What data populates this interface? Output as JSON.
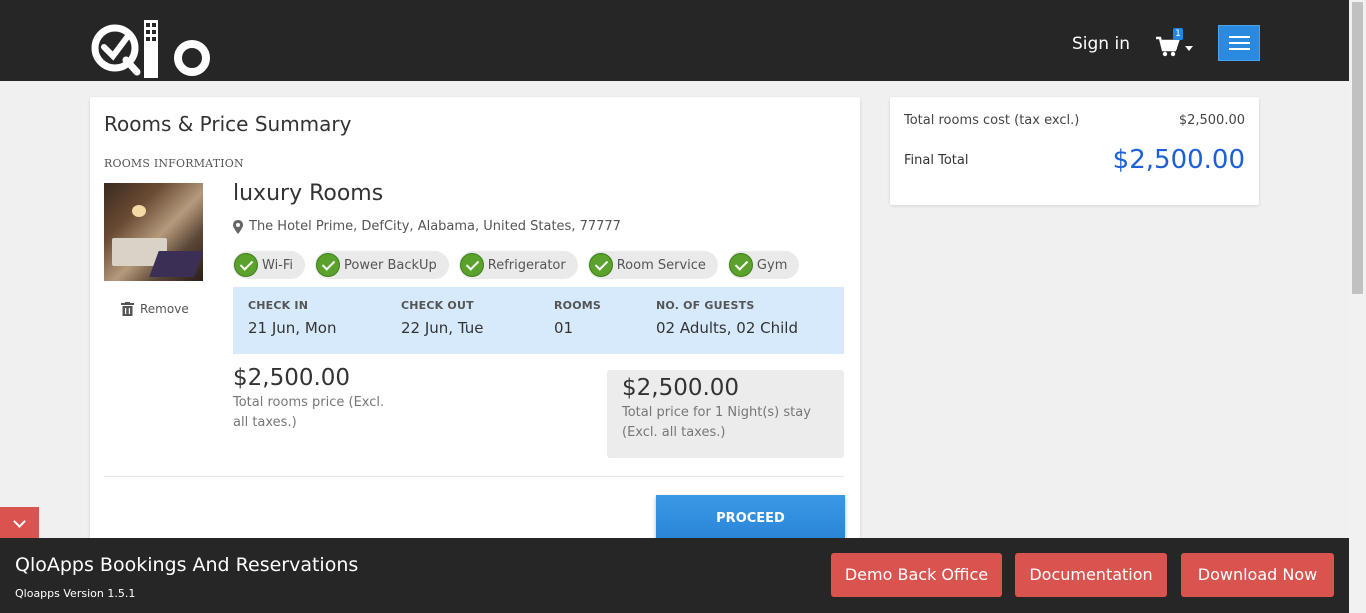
{
  "header": {
    "brand": "Qlo",
    "signin_label": "Sign in",
    "cart_count": "1"
  },
  "summary_card": {
    "title": "Rooms & Price Summary",
    "section_label": "ROOMS INFORMATION",
    "room": {
      "name": "luxury Rooms",
      "address": "The Hotel Prime, DefCity, Alabama, United States, 77777",
      "remove_label": "Remove",
      "features": [
        "Wi-Fi",
        "Power BackUp",
        "Refrigerator",
        "Room Service",
        "Gym"
      ],
      "booking": {
        "check_in_label": "CHECK IN",
        "check_in_value": "21 Jun, Mon",
        "check_out_label": "CHECK OUT",
        "check_out_value": "22 Jun, Tue",
        "rooms_label": "ROOMS",
        "rooms_value": "01",
        "guests_label": "NO. OF GUESTS",
        "guests_value": "02 Adults, 02 Child"
      },
      "total_price": "$2,500.00",
      "total_price_note": "Total rooms price (Excl. all taxes.)",
      "night_price": "$2,500.00",
      "night_price_note": "Total price for 1 Night(s) stay (Excl. all taxes.)"
    },
    "proceed_label": "PROCEED"
  },
  "cost_summary": {
    "rooms_cost_label": "Total rooms cost (tax excl.)",
    "rooms_cost_value": "$2,500.00",
    "final_total_label": "Final Total",
    "final_total_value": "$2,500.00"
  },
  "demo_bar": {
    "title": "QloApps Bookings And Reservations",
    "version": "Qloapps Version 1.5.1",
    "buttons": [
      "Demo Back Office",
      "Documentation",
      "Download Now"
    ]
  },
  "colors": {
    "header_bg": "#262626",
    "accent_blue": "#2a8ae0",
    "total_blue": "#1d5fd6",
    "demo_red": "#d9534f",
    "feature_check": "#5aa22c",
    "info_band": "#d7eafb"
  }
}
